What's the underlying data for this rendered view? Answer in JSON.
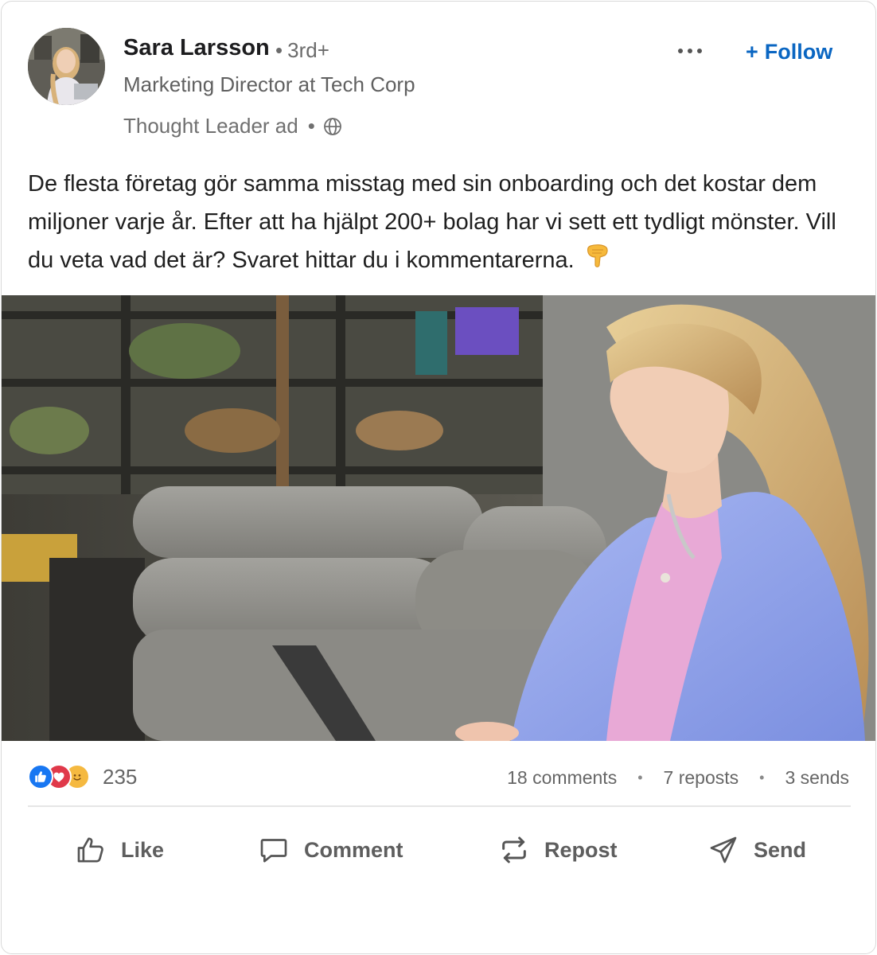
{
  "author": {
    "name": "Sara Larsson",
    "degree": "3rd+",
    "headline": "Marketing Director at Tech Corp",
    "ad_label": "Thought Leader ad",
    "visibility_icon": "globe-icon"
  },
  "header_actions": {
    "more_icon": "more-horizontal-icon",
    "follow_label": "Follow",
    "follow_icon": "plus-icon"
  },
  "post": {
    "text": "De flesta företag gör samma misstag med sin onboarding och det kostar dem miljoner varje år. Efter att ha hjälpt 200+ bolag har vi sett ett tydligt mönster. Vill du veta vad det är? Svaret hittar du i kommentarerna.",
    "trailing_emoji": "pointing-down-hand-icon"
  },
  "social": {
    "reaction_icons": [
      "like-reaction-icon",
      "love-reaction-icon",
      "smile-reaction-icon"
    ],
    "reaction_count": "235",
    "comments": "18 comments",
    "reposts": "7 reposts",
    "sends": "3 sends"
  },
  "actions": [
    {
      "label": "Like",
      "icon": "thumbs-up-icon"
    },
    {
      "label": "Comment",
      "icon": "comment-icon"
    },
    {
      "label": "Repost",
      "icon": "repost-icon"
    },
    {
      "label": "Send",
      "icon": "send-icon"
    }
  ],
  "colors": {
    "accent": "#0a66c2",
    "like_blue": "#1877f2",
    "love_red": "#e0394a",
    "smile_yellow": "#f5b940",
    "text_secondary": "#666666",
    "blazer_blue": "#8fa3ea"
  }
}
